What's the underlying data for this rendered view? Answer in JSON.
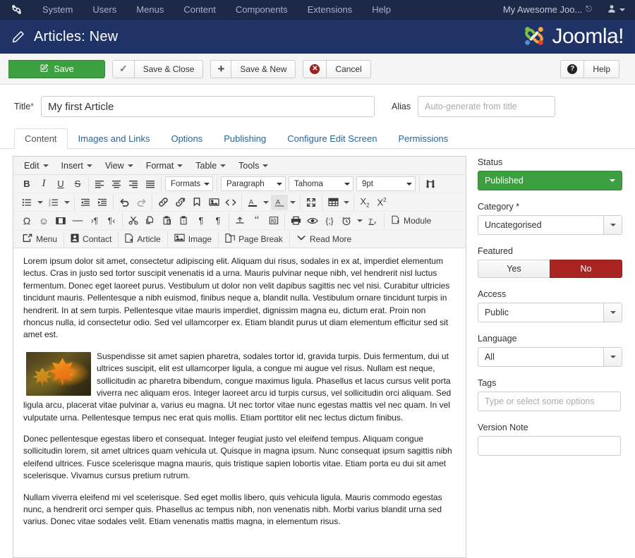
{
  "topbar": {
    "logo_icon": "joomla-mark-icon",
    "menu": [
      {
        "label": "System"
      },
      {
        "label": "Users"
      },
      {
        "label": "Menus"
      },
      {
        "label": "Content"
      },
      {
        "label": "Components"
      },
      {
        "label": "Extensions"
      },
      {
        "label": "Help"
      }
    ],
    "site_name": "My Awesome Joo...",
    "site_link_icon": "external-link-icon",
    "user_icon": "user-icon",
    "user_caret_icon": "chevron-down-icon",
    "background_color": "#1c2a47"
  },
  "pageheader": {
    "icon": "pencil-icon",
    "title": "Articles: New",
    "brand": "Joomla!",
    "brand_mark_icon": "joomla-logo-icon",
    "background_color": "#1f3366"
  },
  "toolbar": {
    "save": {
      "label": "Save",
      "icon": "save-pencil-icon",
      "color": "#3c9f40"
    },
    "save_close": {
      "label": "Save & Close",
      "icon": "check-icon"
    },
    "save_new": {
      "label": "Save & New",
      "icon": "plus-icon"
    },
    "cancel": {
      "label": "Cancel",
      "icon": "cancel-circle-icon",
      "color": "#a01e1e"
    },
    "help": {
      "label": "Help",
      "icon": "question-circle-icon"
    }
  },
  "form": {
    "title_label": "Title",
    "title_required": "*",
    "title_value": "My first Article",
    "alias_label": "Alias",
    "alias_value": "",
    "alias_placeholder": "Auto-generate from title"
  },
  "tabs": [
    {
      "label": "Content",
      "active": true
    },
    {
      "label": "Images and Links",
      "active": false
    },
    {
      "label": "Options",
      "active": false
    },
    {
      "label": "Publishing",
      "active": false
    },
    {
      "label": "Configure Edit Screen",
      "active": false
    },
    {
      "label": "Permissions",
      "active": false
    }
  ],
  "editor": {
    "menubar": [
      {
        "label": "Edit"
      },
      {
        "label": "Insert"
      },
      {
        "label": "View"
      },
      {
        "label": "Format"
      },
      {
        "label": "Table"
      },
      {
        "label": "Tools"
      }
    ],
    "selects": {
      "formats": "Formats",
      "paragraph": "Paragraph",
      "font": "Tahoma",
      "size": "9pt"
    },
    "row1_icons": [
      "bold-icon",
      "italic-icon",
      "underline-icon",
      "strikethrough-icon",
      "align-left-icon",
      "align-center-icon",
      "align-right-icon",
      "align-justify-icon"
    ],
    "search_icon": "find-replace-icon",
    "row2_icons": [
      "bullet-list-icon",
      "numbered-list-icon",
      "outdent-icon",
      "indent-icon",
      "undo-icon",
      "redo-icon",
      "link-icon",
      "unlink-icon",
      "anchor-icon",
      "image-icon",
      "source-code-icon",
      "text-color-icon",
      "background-color-icon",
      "fullscreen-icon",
      "table-icon",
      "subscript-icon",
      "superscript-icon"
    ],
    "row3_icons": [
      "special-character-icon",
      "emoticon-icon",
      "media-icon",
      "horizontal-rule-icon",
      "ltr-icon",
      "rtl-icon",
      "cut-icon",
      "copy-icon",
      "paste-icon",
      "paste-text-icon",
      "show-blocks-icon",
      "nonbreaking-icon",
      "template-icon",
      "blockquote-icon",
      "preview-code-icon",
      "print-icon",
      "preview-icon",
      "code-sample-icon",
      "insert-date-icon",
      "remove-format-icon"
    ],
    "module_button": {
      "label": "Module",
      "icon": "module-icon"
    },
    "plugin_buttons": [
      {
        "label": "Menu",
        "icon": "menu-arrow-icon"
      },
      {
        "label": "Contact",
        "icon": "contact-card-icon"
      },
      {
        "label": "Article",
        "icon": "article-page-icon"
      },
      {
        "label": "Image",
        "icon": "picture-icon"
      },
      {
        "label": "Page Break",
        "icon": "page-break-icon"
      },
      {
        "label": "Read More",
        "icon": "read-more-chevron-icon"
      }
    ],
    "content": {
      "paragraph1": "Lorem ipsum dolor sit amet, consectetur adipiscing elit. Aliquam dui risus, sodales in ex at, imperdiet elementum lectus. Cras in justo sed tortor suscipit venenatis id a urna. Mauris pulvinar neque nibh, vel hendrerit nisl luctus fermentum. Donec eget laoreet purus. Vestibulum ut dolor non velit dapibus sagittis nec vel nisi. Curabitur ultricies tincidunt mauris. Pellentesque a nibh euismod, finibus neque a, blandit nulla. Vestibulum ornare tincidunt turpis in hendrerit. In at sem turpis. Pellentesque vitae mauris imperdiet, dignissim magna eu, dictum erat. Proin non rhoncus nulla, id consectetur odio. Sed vel ullamcorper ex. Etiam blandit purus ut diam elementum efficitur sed sit amet est.",
      "image_alt": "autumn-maple-leaf-photo",
      "paragraph2": "Suspendisse sit amet sapien pharetra, sodales tortor id, gravida turpis. Duis fermentum, dui ut ultrices suscipit, elit est ullamcorper ligula, a congue mi augue vel risus. Nullam est neque, sollicitudin ac pharetra bibendum, congue maximus ligula. Phasellus et lacus cursus velit porta viverra nec aliquam eros. Integer laoreet arcu id turpis cursus, vel sollicitudin orci aliquam. Sed ligula arcu, placerat vitae pulvinar a, varius eu magna. Ut nec tortor vitae nunc egestas mattis vel nec quam. In vel vulputate urna. Pellentesque tempus nec erat quis mollis. Etiam porttitor elit nec lectus dictum finibus.",
      "paragraph3": "Donec pellentesque egestas libero et consequat. Integer feugiat justo vel eleifend tempus. Aliquam congue sollicitudin lorem, sit amet ultrices quam vehicula ut. Quisque in magna ipsum. Nunc consequat ipsum sagittis nibh eleifend ultrices. Fusce scelerisque magna mauris, quis tristique sapien lobortis vitae. Etiam porta eu dui sit amet scelerisque. Vivamus cursus pretium rutrum.",
      "paragraph4": "Nullam viverra eleifend mi vel scelerisque. Sed eget mollis libero, quis vehicula ligula. Mauris commodo egestas nunc, a hendrerit orci semper quis. Phasellus ac tempus nibh, non venenatis nibh. Morbi varius blandit urna sed varius. Donec vitae sodales velit. Etiam venenatis mattis magna, in elementum risus."
    }
  },
  "sidebar": {
    "status": {
      "label": "Status",
      "value": "Published",
      "color": "#3c9f40"
    },
    "category": {
      "label": "Category",
      "required": "*",
      "value": "Uncategorised"
    },
    "featured": {
      "label": "Featured",
      "yes": "Yes",
      "no": "No",
      "selected": "No",
      "no_color": "#a82522"
    },
    "access": {
      "label": "Access",
      "value": "Public"
    },
    "language": {
      "label": "Language",
      "value": "All"
    },
    "tags": {
      "label": "Tags",
      "value": "",
      "placeholder": "Type or select some options"
    },
    "version_note": {
      "label": "Version Note",
      "value": "",
      "placeholder": ""
    }
  }
}
